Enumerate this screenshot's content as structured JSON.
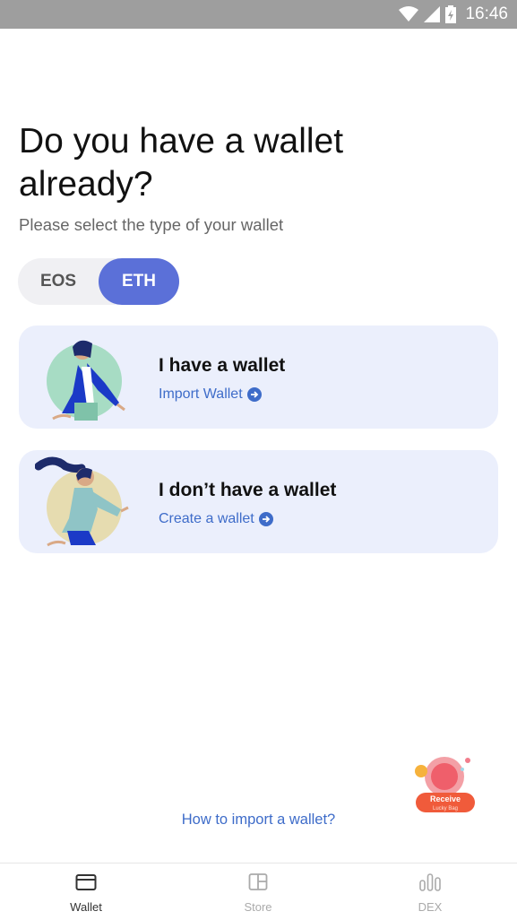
{
  "status_bar": {
    "time": "16:46",
    "icons": [
      "wifi-icon",
      "signal-icon",
      "battery-charging-icon"
    ]
  },
  "header": {
    "title": "Do you have a wallet already?",
    "subtitle": "Please select the type of your wallet"
  },
  "wallet_type": {
    "options": [
      "EOS",
      "ETH"
    ],
    "selected": "ETH"
  },
  "cards": [
    {
      "title": "I have a wallet",
      "link": "Import Wallet",
      "icon": "arrow-right-circle-icon"
    },
    {
      "title": "I don’t have a wallet",
      "link": "Create a wallet",
      "icon": "arrow-right-circle-icon"
    }
  ],
  "lucky_bag": {
    "label": "Receive",
    "sublabel": "Lucky Bag"
  },
  "help_link": "How to import a wallet?",
  "bottom_nav": {
    "items": [
      {
        "label": "Wallet",
        "icon": "wallet-icon",
        "active": true
      },
      {
        "label": "Store",
        "icon": "store-icon",
        "active": false
      },
      {
        "label": "DEX",
        "icon": "dex-chart-icon",
        "active": false
      }
    ]
  },
  "colors": {
    "accent": "#5b70d8",
    "link": "#3e6cc9",
    "card_bg": "#ebeffc",
    "status_bar": "#9e9e9e"
  }
}
